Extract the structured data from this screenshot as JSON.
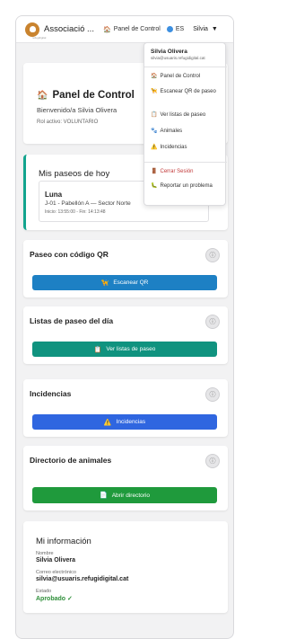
{
  "header": {
    "app_title": "Associació ...",
    "logo_caption": "refugidigital",
    "nav_panel": "Panel de Control",
    "language": "ES",
    "user": "Silvia"
  },
  "dashboard": {
    "title": "Panel de Control",
    "welcome": "Bienvenido/a Silvia Olivera",
    "role": "Rol activo: VOLUNTARIO"
  },
  "walks": {
    "title": "Mis paseos de hoy",
    "items": [
      {
        "name": "Luna",
        "location": "J-01 - Pabellón A — Sector Norte",
        "time": "Inicio: 13:55:00 - Fin: 14:13:48"
      }
    ]
  },
  "sections": {
    "qr": {
      "title": "Paseo con código QR",
      "button": "Escanear QR"
    },
    "lists": {
      "title": "Listas de paseo del día",
      "button": "Ver listas de paseo"
    },
    "incidents": {
      "title": "Incidencias",
      "button": "Incidencias"
    },
    "directory": {
      "title": "Directorio de animales",
      "button": "Abrir directorio"
    }
  },
  "my_info": {
    "title": "Mi información",
    "name_label": "Nombre",
    "name": "Silvia Olivera",
    "email_label": "Correo electrónico",
    "email": "silvia@usuaris.refugidigital.cat",
    "status_label": "Estado",
    "status": "Aprobado ✓"
  },
  "dropdown": {
    "name": "Silvia Olivera",
    "email": "silvia@usuaris.refugidigital.cat",
    "items": [
      "Panel de Control",
      "Escanear QR de paseo",
      "Ver listas de paseo",
      "Animales",
      "Incidencias"
    ],
    "logout": "Cerrar Sesión",
    "report": "Reportar un problema"
  },
  "icons": {
    "info": "ⓘ",
    "caret": "▼"
  },
  "colors": {
    "accent_teal": "#13a48e",
    "qr_button": "#1d80c4",
    "lists_button": "#10937f",
    "incidents_button": "#2f66e0",
    "directory_button": "#1f9a3c",
    "logout_text": "#c23a3a"
  }
}
